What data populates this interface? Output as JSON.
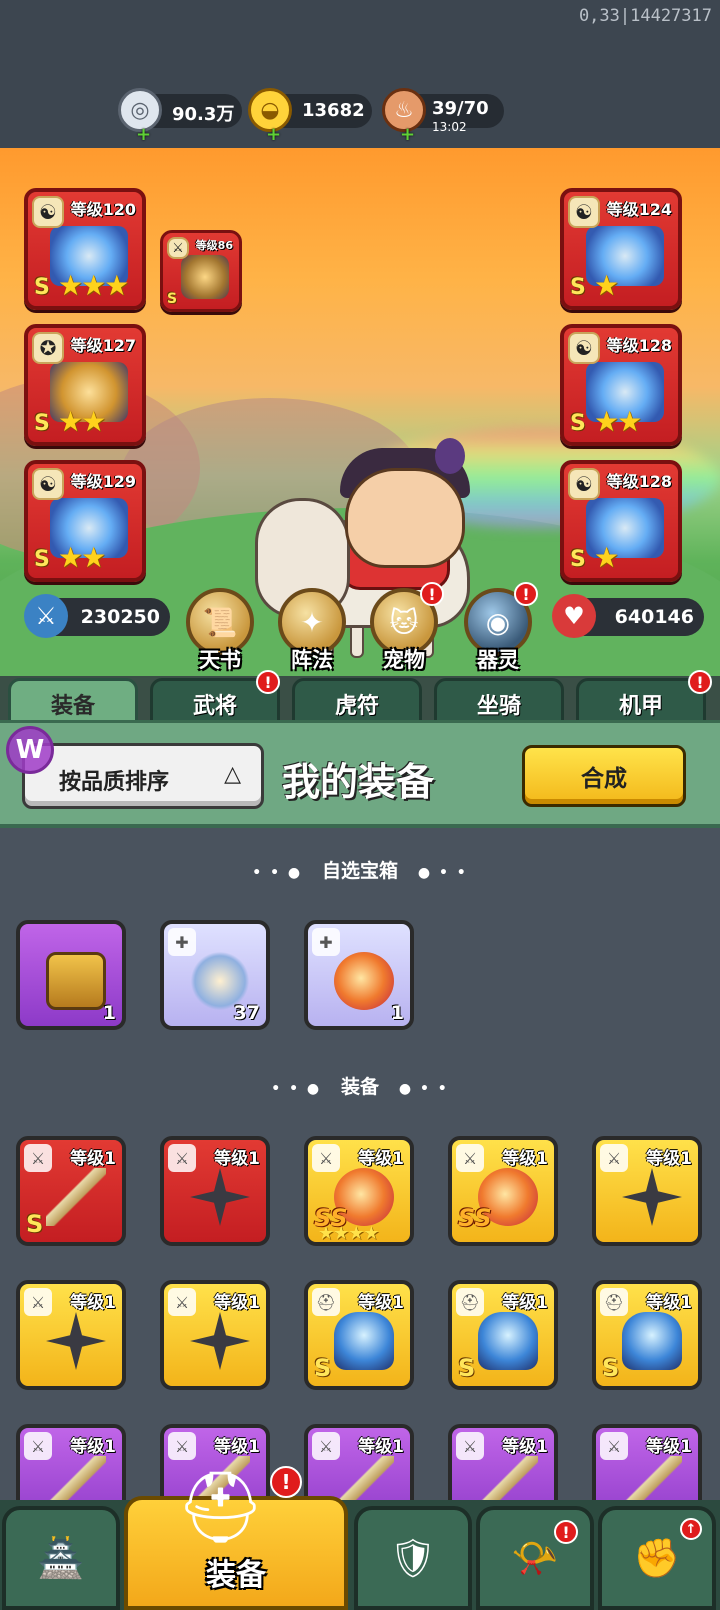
{
  "debug_text": "0,33|14427317",
  "resources": {
    "silver": {
      "value": "90.3万",
      "icon": "coin-icon"
    },
    "gold": {
      "value": "13682",
      "icon": "gold-ingot-icon"
    },
    "stamina": {
      "value": "39/70",
      "timer": "13:02",
      "icon": "meat-icon"
    }
  },
  "equipped": {
    "left": [
      {
        "level": "等级120",
        "grade": "S",
        "stars": "★★★"
      },
      {
        "level": "等级127",
        "grade": "S",
        "stars": "★★"
      },
      {
        "level": "等级129",
        "grade": "S",
        "stars": "★★"
      }
    ],
    "weapon_small": {
      "level": "等级86",
      "grade": "S"
    },
    "right": [
      {
        "level": "等级124",
        "grade": "S",
        "stars": "★"
      },
      {
        "level": "等级128",
        "grade": "S",
        "stars": "★★"
      },
      {
        "level": "等级128",
        "grade": "S",
        "stars": "★"
      }
    ]
  },
  "stats": {
    "attack": "230250",
    "health": "640146"
  },
  "functions": [
    {
      "label": "天书",
      "icon": "scroll-icon",
      "alert": false
    },
    {
      "label": "阵法",
      "icon": "formation-icon",
      "alert": false
    },
    {
      "label": "宠物",
      "icon": "pet-icon",
      "alert": true
    },
    {
      "label": "器灵",
      "icon": "spirit-icon",
      "alert": true
    }
  ],
  "tabs": [
    {
      "label": "装备",
      "active": true,
      "alert": false
    },
    {
      "label": "武将",
      "active": false,
      "alert": true
    },
    {
      "label": "虎符",
      "active": false,
      "alert": false
    },
    {
      "label": "坐骑",
      "active": false,
      "alert": false
    },
    {
      "label": "机甲",
      "active": false,
      "alert": true
    }
  ],
  "panel": {
    "sort_label": "按品质排序",
    "title": "我的装备",
    "synth_label": "合成",
    "logo_letter": "W"
  },
  "sections": {
    "chests_title": "自选宝箱",
    "equipment_title": "装备"
  },
  "chests": [
    {
      "count": "1",
      "color": "purple"
    },
    {
      "count": "37",
      "color": "lavender"
    },
    {
      "count": "1",
      "color": "lavender"
    }
  ],
  "equipment_rows": [
    [
      {
        "level": "等级1",
        "color": "red",
        "grade": "S",
        "art": "sword"
      },
      {
        "level": "等级1",
        "color": "red",
        "grade": "",
        "art": "shuriken"
      },
      {
        "level": "等级1",
        "color": "gold",
        "grade": "SS",
        "art": "bird",
        "stars": "★★★★"
      },
      {
        "level": "等级1",
        "color": "gold",
        "grade": "SS",
        "art": "bird",
        "stars": ""
      },
      {
        "level": "等级1",
        "color": "gold",
        "grade": "",
        "art": "shuriken"
      }
    ],
    [
      {
        "level": "等级1",
        "color": "gold",
        "grade": "",
        "art": "shuriken"
      },
      {
        "level": "等级1",
        "color": "gold",
        "grade": "",
        "art": "shuriken"
      },
      {
        "level": "等级1",
        "color": "gold",
        "grade": "S",
        "art": "helm"
      },
      {
        "level": "等级1",
        "color": "gold",
        "grade": "S",
        "art": "helm"
      },
      {
        "level": "等级1",
        "color": "gold",
        "grade": "S",
        "art": "helm"
      }
    ],
    [
      {
        "level": "等级1",
        "color": "purple",
        "grade": "",
        "art": "sword"
      },
      {
        "level": "等级1",
        "color": "purple",
        "grade": "",
        "art": "sword"
      },
      {
        "level": "等级1",
        "color": "purple",
        "grade": "",
        "art": "sword"
      },
      {
        "level": "等级1",
        "color": "purple",
        "grade": "",
        "art": "sword"
      },
      {
        "level": "等级1",
        "color": "purple",
        "grade": "",
        "art": "sword"
      }
    ]
  ],
  "nav": [
    {
      "label": "",
      "icon": "castle-icon",
      "active": false
    },
    {
      "label": "装备",
      "icon": "helmet-icon",
      "active": true,
      "alert": true
    },
    {
      "label": "",
      "icon": "shield-swords-icon",
      "active": false
    },
    {
      "label": "",
      "icon": "horn-icon",
      "active": false,
      "alert": true
    },
    {
      "label": "",
      "icon": "upgrade-fist-icon",
      "active": false,
      "upgrade": true
    }
  ]
}
